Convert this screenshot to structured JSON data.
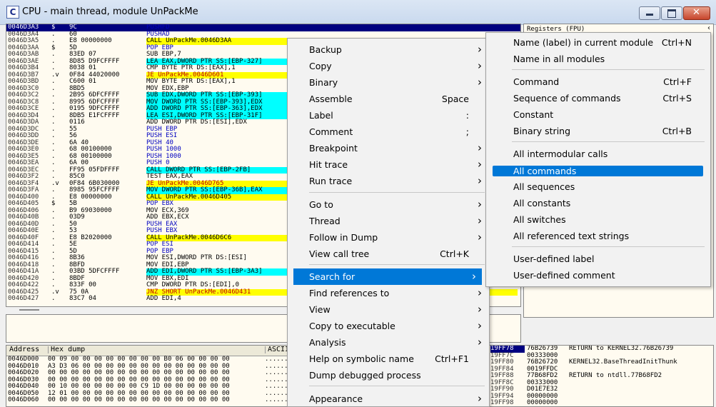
{
  "window": {
    "title": "CPU - main thread, module UnPackMe",
    "icon_letter": "C"
  },
  "registers": {
    "title": "Registers (FPU)"
  },
  "disasm": [
    {
      "addr": "0046D3A3",
      "mark": "$",
      "hex": "9C",
      "instr": "PUSHFD"
    },
    {
      "addr": "0046D3A4",
      "mark": ".",
      "hex": "60",
      "instr": "PUSHAD"
    },
    {
      "addr": "0046D3A5",
      "mark": ".",
      "hex": "E8 00000000",
      "instr": "CALL UnPackMe.0046D3AA"
    },
    {
      "addr": "0046D3AA",
      "mark": "$",
      "hex": "5D",
      "instr": "POP EBP"
    },
    {
      "addr": "0046D3AB",
      "mark": ".",
      "hex": "83ED 07",
      "instr": "SUB EBP,7"
    },
    {
      "addr": "0046D3AE",
      "mark": ".",
      "hex": "8D85 D9FCFFFF",
      "instr": "LEA EAX,DWORD PTR SS:[EBP-327]"
    },
    {
      "addr": "0046D3B4",
      "mark": ".",
      "hex": "8038 01",
      "instr": "CMP BYTE PTR DS:[EAX],1"
    },
    {
      "addr": "0046D3B7",
      "mark": ".v",
      "hex": "0F84 44020000",
      "instr": "JE UnPackMe.0046D601"
    },
    {
      "addr": "0046D3BD",
      "mark": ".",
      "hex": "C600 01",
      "instr": "MOV BYTE PTR DS:[EAX],1"
    },
    {
      "addr": "0046D3C0",
      "mark": ".",
      "hex": "8BD5",
      "instr": "MOV EDX,EBP"
    },
    {
      "addr": "0046D3C2",
      "mark": ".",
      "hex": "2B95 6DFCFFFF",
      "instr": "SUB EDX,DWORD PTR SS:[EBP-393]"
    },
    {
      "addr": "0046D3C8",
      "mark": ".",
      "hex": "8995 6DFCFFFF",
      "instr": "MOV DWORD PTR SS:[EBP-393],EDX"
    },
    {
      "addr": "0046D3CE",
      "mark": ".",
      "hex": "0195 9DFCFFFF",
      "instr": "ADD DWORD PTR SS:[EBP-363],EDX"
    },
    {
      "addr": "0046D3D4",
      "mark": ".",
      "hex": "8DB5 E1FCFFFF",
      "instr": "LEA ESI,DWORD PTR SS:[EBP-31F]"
    },
    {
      "addr": "0046D3DA",
      "mark": ".",
      "hex": "0116",
      "instr": "ADD DWORD PTR DS:[ESI],EDX"
    },
    {
      "addr": "0046D3DC",
      "mark": ".",
      "hex": "55",
      "instr": "PUSH EBP"
    },
    {
      "addr": "0046D3DD",
      "mark": ".",
      "hex": "56",
      "instr": "PUSH ESI"
    },
    {
      "addr": "0046D3DE",
      "mark": ".",
      "hex": "6A 40",
      "instr": "PUSH 40"
    },
    {
      "addr": "0046D3E0",
      "mark": ".",
      "hex": "68 00100000",
      "instr": "PUSH 1000"
    },
    {
      "addr": "0046D3E5",
      "mark": ".",
      "hex": "68 00100000",
      "instr": "PUSH 1000"
    },
    {
      "addr": "0046D3EA",
      "mark": ".",
      "hex": "6A 00",
      "instr": "PUSH 0"
    },
    {
      "addr": "0046D3EC",
      "mark": ".",
      "hex": "FF95 05FDFFFF",
      "instr": "CALL DWORD PTR SS:[EBP-2FB]"
    },
    {
      "addr": "0046D3F2",
      "mark": ".",
      "hex": "85C0",
      "instr": "TEST EAX,EAX"
    },
    {
      "addr": "0046D3F4",
      "mark": ".v",
      "hex": "0F84 6B030000",
      "instr": "JE UnPackMe.0046D765"
    },
    {
      "addr": "0046D3FA",
      "mark": ".",
      "hex": "8985 95FCFFFF",
      "instr": "MOV DWORD PTR SS:[EBP-36B],EAX"
    },
    {
      "addr": "0046D400",
      "mark": ".",
      "hex": "E8 00000000",
      "instr": "CALL UnPackMe.0046D405"
    },
    {
      "addr": "0046D405",
      "mark": "$",
      "hex": "5B",
      "instr": "POP EBX"
    },
    {
      "addr": "0046D406",
      "mark": ".",
      "hex": "B9 69030000",
      "instr": "MOV ECX,369"
    },
    {
      "addr": "0046D40B",
      "mark": ".",
      "hex": "03D9",
      "instr": "ADD EBX,ECX"
    },
    {
      "addr": "0046D40D",
      "mark": ".",
      "hex": "50",
      "instr": "PUSH EAX"
    },
    {
      "addr": "0046D40E",
      "mark": ".",
      "hex": "53",
      "instr": "PUSH EBX"
    },
    {
      "addr": "0046D40F",
      "mark": ".",
      "hex": "E8 B2020000",
      "instr": "CALL UnPackMe.0046D6C6"
    },
    {
      "addr": "0046D414",
      "mark": ".",
      "hex": "5E",
      "instr": "POP ESI"
    },
    {
      "addr": "0046D415",
      "mark": ".",
      "hex": "5D",
      "instr": "POP EBP"
    },
    {
      "addr": "0046D416",
      "mark": ".",
      "hex": "8B36",
      "instr": "MOV ESI,DWORD PTR DS:[ESI]"
    },
    {
      "addr": "0046D418",
      "mark": ".",
      "hex": "8BFD",
      "instr": "MOV EDI,EBP"
    },
    {
      "addr": "0046D41A",
      "mark": ".",
      "hex": "03BD 5DFCFFFF",
      "instr": "ADD EDI,DWORD PTR SS:[EBP-3A3]"
    },
    {
      "addr": "0046D420",
      "mark": ".",
      "hex": "8BDF",
      "instr": "MOV EBX,EDI"
    },
    {
      "addr": "0046D422",
      "mark": ".",
      "hex": "833F 00",
      "instr": "CMP DWORD PTR DS:[EDI],0"
    },
    {
      "addr": "0046D425",
      "mark": ".v",
      "hex": "75 0A",
      "instr": "JNZ SHORT UnPackMe.0046D431"
    },
    {
      "addr": "0046D427",
      "mark": ".",
      "hex": "83C7 04",
      "instr": "ADD EDI,4"
    }
  ],
  "dump": {
    "col_address": "Address",
    "col_hex": "Hex dump",
    "col_ascii": "ASCII",
    "rows": [
      {
        "addr": "0046D000",
        "hex": "00 09 00 00 00 00 00 00 00 00 B0 06 00 00 00 00",
        "ascii": "......"
      },
      {
        "addr": "0046D010",
        "hex": "A3 D3 06 00 00 00 00 00 00 00 00 00 00 00 00 00",
        "ascii": "......"
      },
      {
        "addr": "0046D020",
        "hex": "00 00 00 00 00 00 00 00 00 00 00 00 00 00 00 00",
        "ascii": "......"
      },
      {
        "addr": "0046D030",
        "hex": "00 00 00 00 00 00 00 00 00 00 00 00 00 00 00 00",
        "ascii": "......"
      },
      {
        "addr": "0046D040",
        "hex": "00 10 00 00 00 00 00 00 C9 1D 00 00 00 00 00 00",
        "ascii": "......"
      },
      {
        "addr": "0046D050",
        "hex": "12 01 00 00 00 00 00 00 00 00 00 00 00 00 00 00",
        "ascii": "......"
      },
      {
        "addr": "0046D060",
        "hex": "00 00 00 00 00 00 00 00 00 00 00 00 00 00 00 00",
        "ascii": "......"
      }
    ]
  },
  "stack": [
    {
      "addr": "19FF78",
      "val": "76B26739",
      "cmt": "RETURN to KERNEL32.76B26739"
    },
    {
      "addr": "19FF7C",
      "val": "00333000",
      "cmt": ""
    },
    {
      "addr": "19FF80",
      "val": "76B26720",
      "cmt": "KERNEL32.BaseThreadInitThunk"
    },
    {
      "addr": "19FF84",
      "val": "0019FFDC",
      "cmt": ""
    },
    {
      "addr": "19FF88",
      "val": "77B68FD2",
      "cmt": "RETURN to ntdll.77B68FD2"
    },
    {
      "addr": "19FF8C",
      "val": "00333000",
      "cmt": ""
    },
    {
      "addr": "19FF90",
      "val": "D01E7E32",
      "cmt": ""
    },
    {
      "addr": "19FF94",
      "val": "00000000",
      "cmt": ""
    },
    {
      "addr": "19FF98",
      "val": "00000000",
      "cmt": ""
    }
  ],
  "context_menu": {
    "items": [
      {
        "label": "Backup",
        "shortcut": "",
        "arrow": true
      },
      {
        "label": "Copy",
        "shortcut": "",
        "arrow": true
      },
      {
        "label": "Binary",
        "shortcut": "",
        "arrow": true
      },
      {
        "label": "Assemble",
        "shortcut": "Space",
        "arrow": false
      },
      {
        "label": "Label",
        "shortcut": ":",
        "arrow": false
      },
      {
        "label": "Comment",
        "shortcut": ";",
        "arrow": false
      },
      {
        "label": "Breakpoint",
        "shortcut": "",
        "arrow": true
      },
      {
        "label": "Hit trace",
        "shortcut": "",
        "arrow": true
      },
      {
        "label": "Run trace",
        "shortcut": "",
        "arrow": true
      },
      {
        "label": "Go to",
        "shortcut": "",
        "arrow": true
      },
      {
        "label": "Thread",
        "shortcut": "",
        "arrow": true
      },
      {
        "label": "Follow in Dump",
        "shortcut": "",
        "arrow": true
      },
      {
        "label": "View call tree",
        "shortcut": "Ctrl+K",
        "arrow": false
      },
      {
        "label": "Search for",
        "shortcut": "",
        "arrow": true
      },
      {
        "label": "Find references to",
        "shortcut": "",
        "arrow": true
      },
      {
        "label": "View",
        "shortcut": "",
        "arrow": true
      },
      {
        "label": "Copy to executable",
        "shortcut": "",
        "arrow": true
      },
      {
        "label": "Analysis",
        "shortcut": "",
        "arrow": true
      },
      {
        "label": "Help on symbolic name",
        "shortcut": "Ctrl+F1",
        "arrow": false
      },
      {
        "label": "Dump debugged process",
        "shortcut": "",
        "arrow": false
      },
      {
        "label": "Appearance",
        "shortcut": "",
        "arrow": true
      }
    ]
  },
  "submenu": {
    "items": [
      {
        "label": "Name (label) in current module",
        "shortcut": "Ctrl+N"
      },
      {
        "label": "Name in all modules",
        "shortcut": ""
      },
      {
        "label": "Command",
        "shortcut": "Ctrl+F"
      },
      {
        "label": "Sequence of commands",
        "shortcut": "Ctrl+S"
      },
      {
        "label": "Constant",
        "shortcut": ""
      },
      {
        "label": "Binary string",
        "shortcut": "Ctrl+B"
      },
      {
        "label": "All intermodular calls",
        "shortcut": ""
      },
      {
        "label": "All commands",
        "shortcut": ""
      },
      {
        "label": "All sequences",
        "shortcut": ""
      },
      {
        "label": "All constants",
        "shortcut": ""
      },
      {
        "label": "All switches",
        "shortcut": ""
      },
      {
        "label": "All referenced text strings",
        "shortcut": ""
      },
      {
        "label": "User-defined label",
        "shortcut": ""
      },
      {
        "label": "User-defined comment",
        "shortcut": ""
      }
    ]
  }
}
